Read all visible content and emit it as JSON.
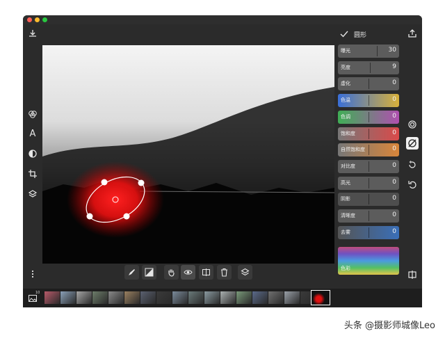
{
  "panel": {
    "title": "圆形"
  },
  "adjustments": [
    {
      "label": "曝光",
      "value": "30",
      "color": "#5c5c5c"
    },
    {
      "label": "亮度",
      "value": "9",
      "color": "#5c5c5c"
    },
    {
      "label": "虚化",
      "value": "0",
      "color": "#5c5c5c"
    },
    {
      "label": "色温",
      "value": "0",
      "color": "linear-gradient(90deg,#3a6fd8,#d8b13a)"
    },
    {
      "label": "色调",
      "value": "0",
      "color": "linear-gradient(90deg,#3fae55,#b04fb0)"
    },
    {
      "label": "饱和度",
      "value": "0",
      "color": "linear-gradient(90deg,#777,#d94a4a)"
    },
    {
      "label": "自然饱和度",
      "value": "0",
      "color": "linear-gradient(90deg,#777,#d9863a)"
    },
    {
      "label": "对比度",
      "value": "0",
      "color": "#5c5c5c"
    },
    {
      "label": "高光",
      "value": "0",
      "color": "#5c5c5c"
    },
    {
      "label": "阴影",
      "value": "0",
      "color": "#4e4e4e"
    },
    {
      "label": "清晰度",
      "value": "0",
      "color": "#5c5c5c"
    },
    {
      "label": "去雾",
      "value": "0",
      "color": "linear-gradient(90deg,#555,#3a6fb8)"
    }
  ],
  "color_section": {
    "label": "色彩"
  },
  "filmstrip": {
    "count_label": "10"
  },
  "watermark": {
    "text": "头条 @摄影师城像Leo"
  }
}
